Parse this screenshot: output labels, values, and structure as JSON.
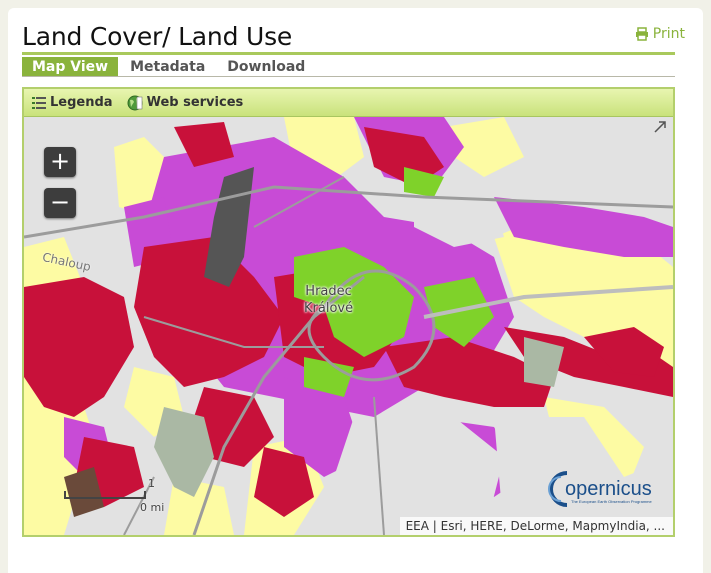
{
  "page": {
    "title": "Land Cover/ Land Use",
    "print_label": "Print"
  },
  "tabs": [
    {
      "label": "Map View",
      "active": true
    },
    {
      "label": "Metadata",
      "active": false
    },
    {
      "label": "Download",
      "active": false
    }
  ],
  "toolbar": {
    "legend_label": "Legenda",
    "web_services_label": "Web services"
  },
  "map": {
    "zoom_in_label": "+",
    "zoom_out_label": "−",
    "city_line1": "Hradec",
    "city_line2": "Králové",
    "road_label": "Chaloup",
    "scale_label_top": "1",
    "scale_label_bottom": "0 mi",
    "logo_text": "opernicus",
    "logo_subtext": "The European Earth Observation Programme",
    "attribution": "EEA | Esri, HERE, DeLorme, MapmyIndia, ..."
  },
  "icons": {
    "print": "printer-icon",
    "legend": "list-icon",
    "web_services": "globe-icon",
    "expand": "expand-icon"
  },
  "colors": {
    "accent": "#8ab33c",
    "urban_dense": "#c8113a",
    "commercial": "#c84bd6",
    "agricultural": "#fdfba3",
    "green_urban": "#7fd22a",
    "industrial_grey": "#555555",
    "sport": "#b6c8b0"
  }
}
